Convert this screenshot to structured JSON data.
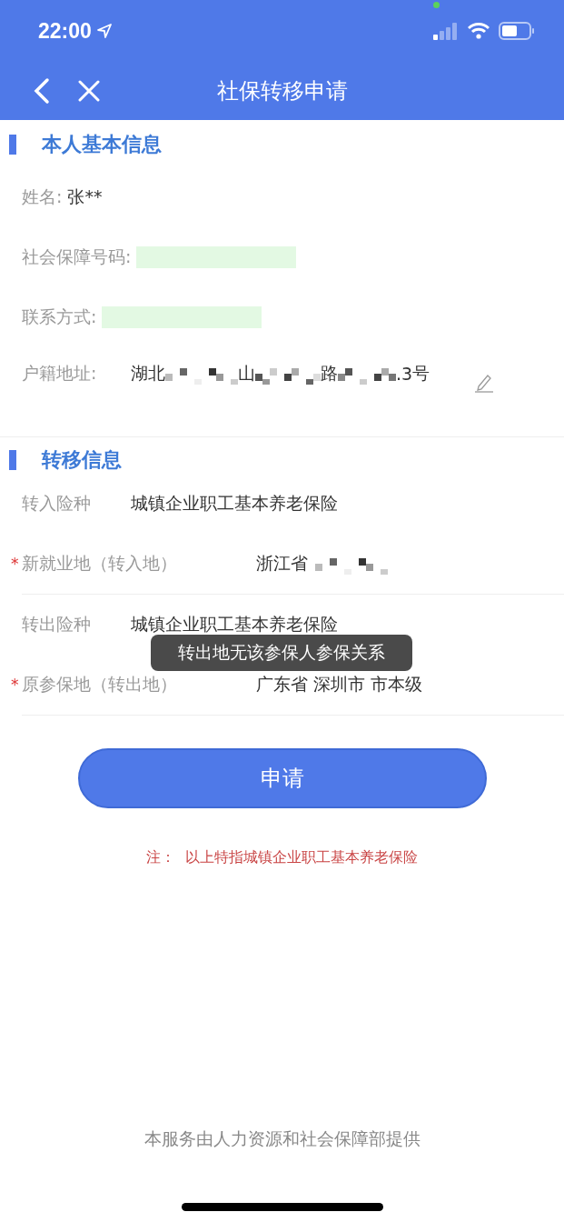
{
  "status_bar": {
    "time": "22:00"
  },
  "nav": {
    "title": "社保转移申请"
  },
  "sections": [
    {
      "title": "本人基本信息",
      "rows": [
        {
          "kind": "text",
          "label": "姓名:",
          "value": "张**"
        },
        {
          "kind": "redacted",
          "label": "社会保障号码:"
        },
        {
          "kind": "redacted",
          "label": "联系方式:"
        },
        {
          "kind": "address",
          "label": "户籍地址:",
          "parts": [
            {
              "kind": "text",
              "text": "湖北"
            },
            {
              "kind": "mosaic"
            },
            {
              "kind": "text",
              "text": "山"
            },
            {
              "kind": "mosaic"
            },
            {
              "kind": "text",
              "text": "路"
            },
            {
              "kind": "mosaic"
            },
            {
              "kind": "text",
              "text": ".3"
            },
            {
              "kind": "text",
              "text": "号"
            }
          ]
        }
      ]
    },
    {
      "title": "转移信息",
      "rows": [
        {
          "kind": "text",
          "label": "转入险种",
          "value": "城镇企业职工基本养老保险"
        },
        {
          "kind": "place",
          "required_mark": "*",
          "label": "新就业地（转入地）",
          "value": "浙江省",
          "masked": true
        },
        {
          "kind": "text",
          "label": "转出险种",
          "value": "城镇企业职工基本养老保险"
        },
        {
          "kind": "place",
          "required_mark": "*",
          "label": "原参保地（转出地）",
          "value": "广东省 深圳市 市本级",
          "masked": false
        }
      ]
    }
  ],
  "toast": "转出地无该参保人参保关系",
  "submit_button": "申请",
  "note": {
    "prefix": "注：",
    "text": "以上特指城镇企业职工基本养老保险"
  },
  "footer": "本服务由人力资源和社会保障部提供"
}
